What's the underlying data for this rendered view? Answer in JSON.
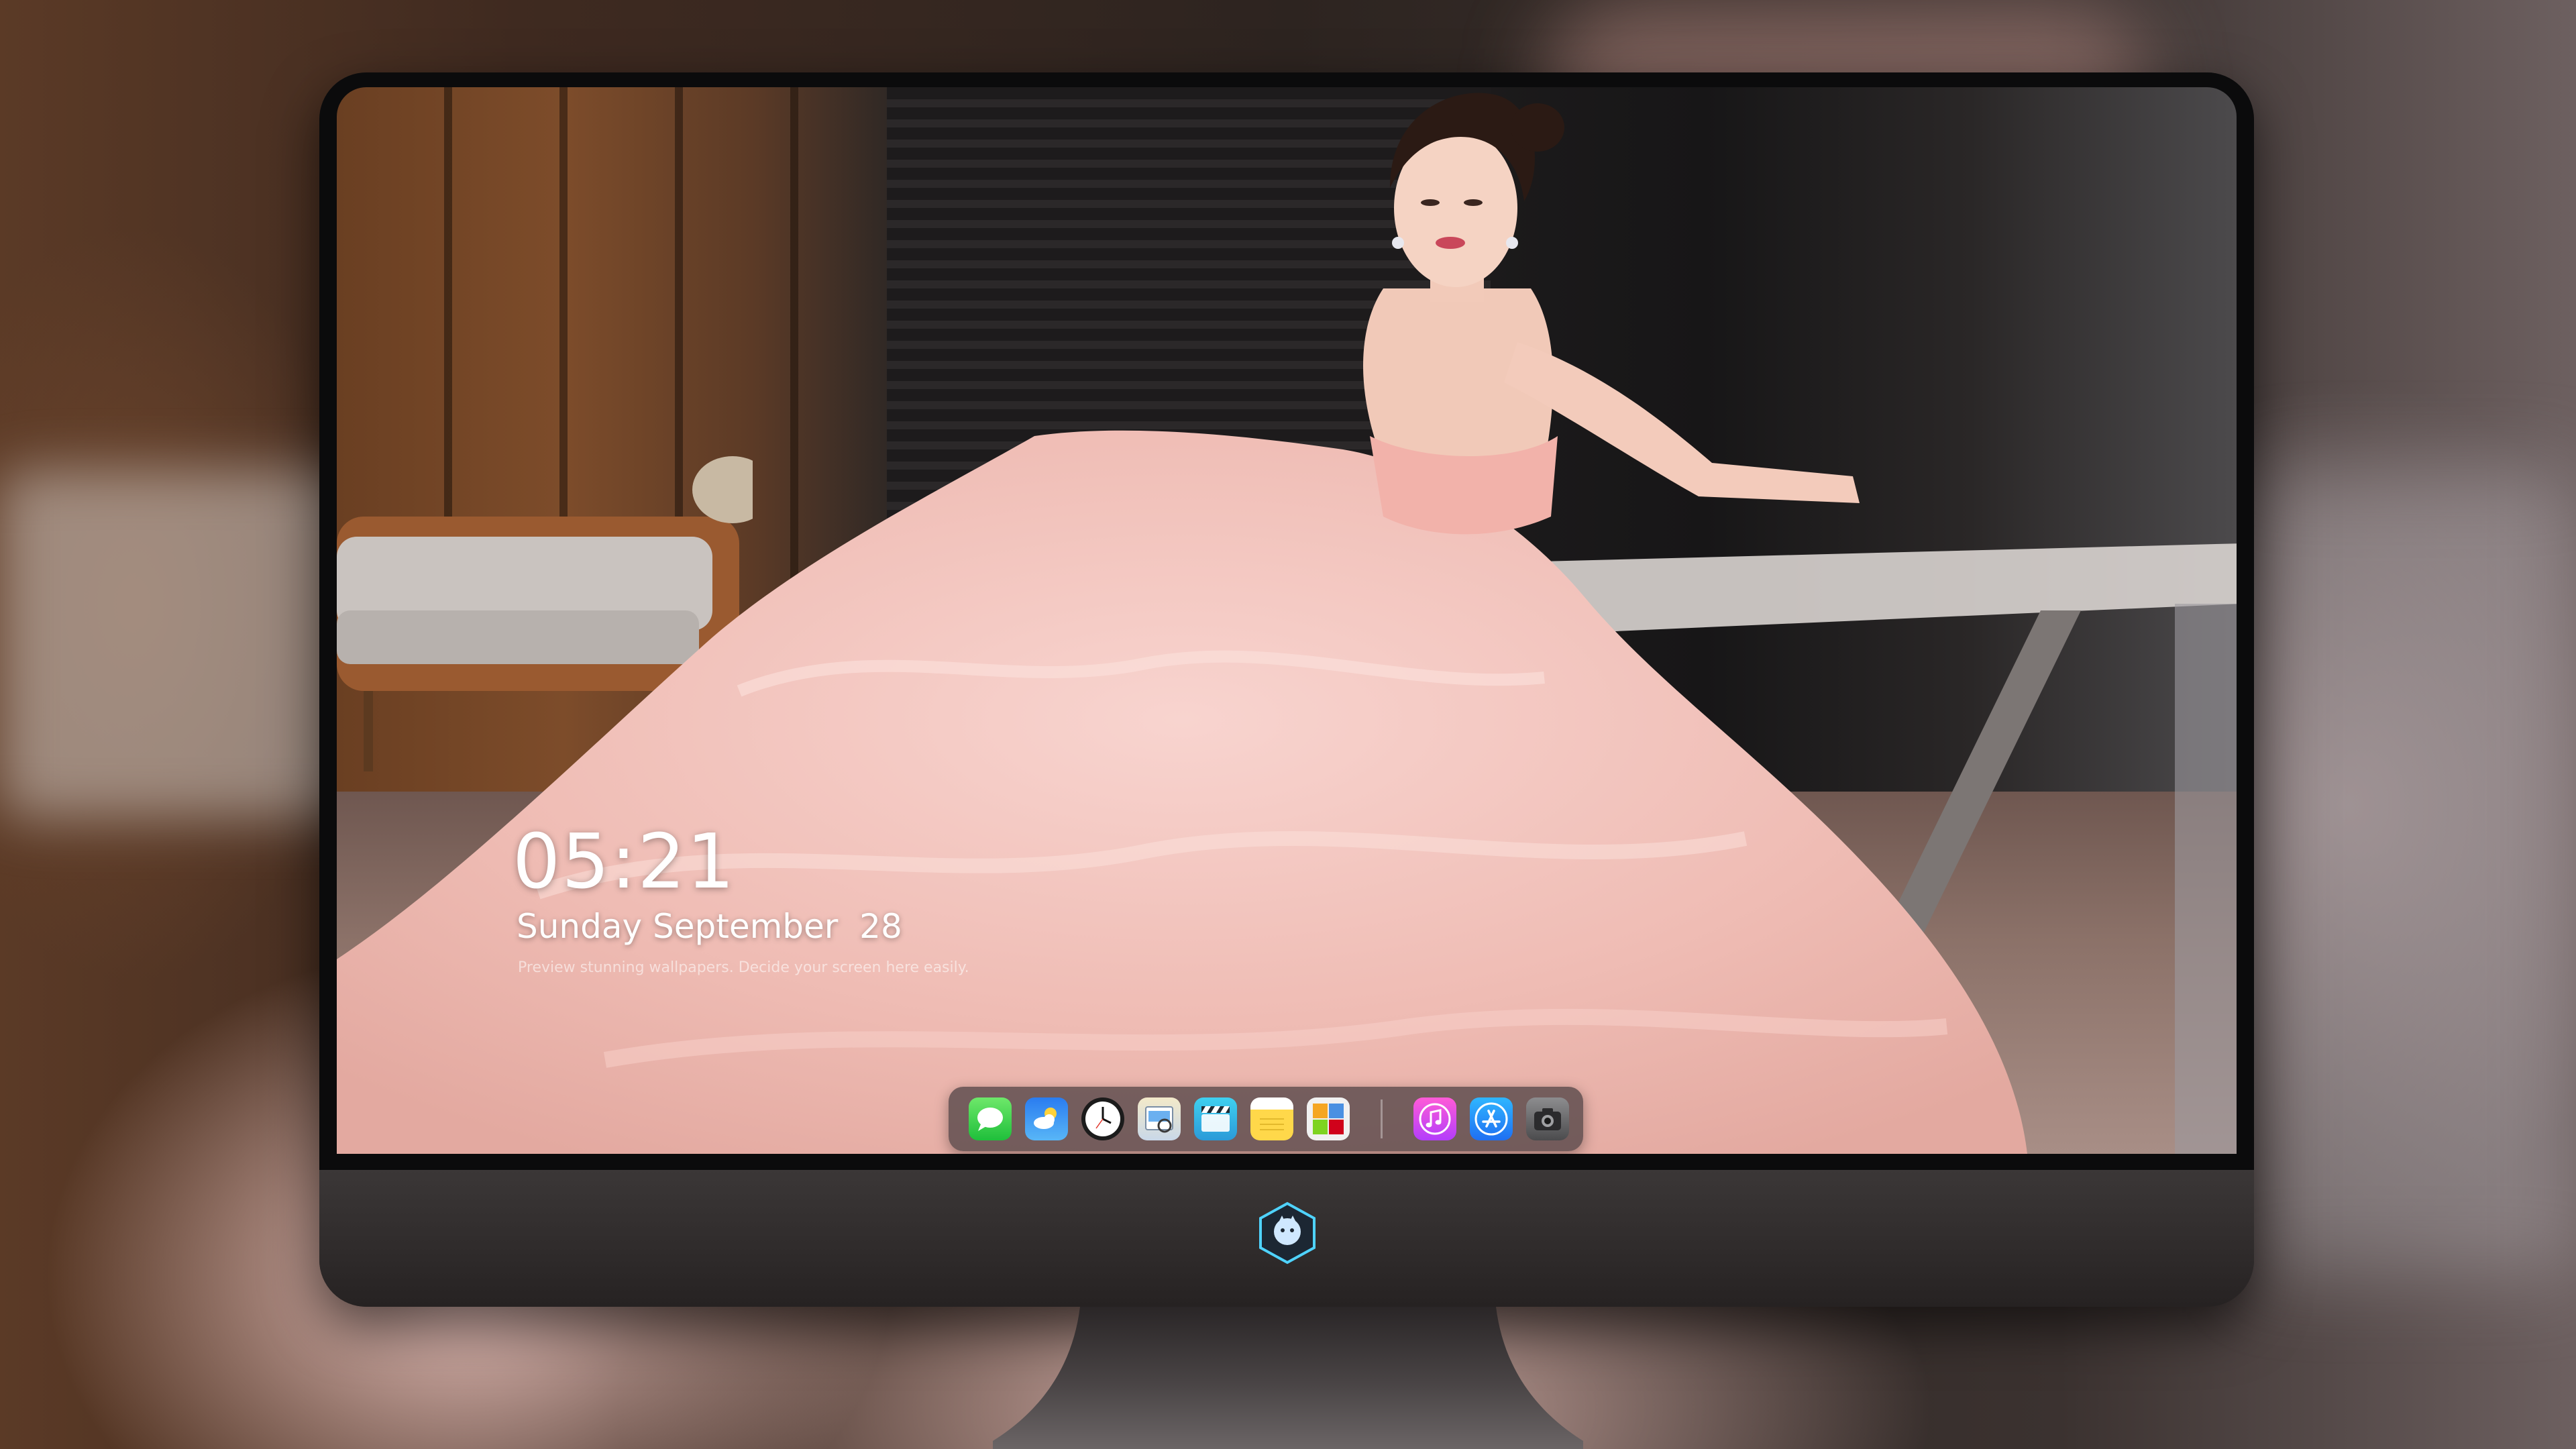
{
  "lock_screen": {
    "time": "05:21",
    "date": "Sunday September  28",
    "preview_note": "Preview stunning wallpapers. Decide your screen here easily."
  },
  "dock": {
    "apps": [
      {
        "name": "messages",
        "icon": "message-bubble-icon",
        "color": "#1fbf3b"
      },
      {
        "name": "weather",
        "icon": "cloud-sun-icon",
        "color": "#2a7cf0"
      },
      {
        "name": "clock",
        "icon": "clock-icon",
        "color": "#1b1b1b"
      },
      {
        "name": "preview",
        "icon": "preview-icon",
        "color": "#c9d8e8"
      },
      {
        "name": "clips",
        "icon": "clapperboard-icon",
        "color": "#2a9ad8"
      },
      {
        "name": "notes",
        "icon": "notepad-icon",
        "color": "#ffd84a"
      },
      {
        "name": "photos",
        "icon": "photo-grid-icon",
        "color": "#f1f1f1"
      },
      {
        "name": "music",
        "icon": "music-note-icon",
        "color": "#b33dfb"
      },
      {
        "name": "app-store",
        "icon": "app-store-icon",
        "color": "#1f6ff2"
      },
      {
        "name": "camera",
        "icon": "camera-icon",
        "color": "#4b4b4d"
      }
    ]
  },
  "colors": {
    "monitor_body": "#2a2626",
    "dock_background": "#463c3e",
    "dress_pink": "#f3c6c0"
  }
}
